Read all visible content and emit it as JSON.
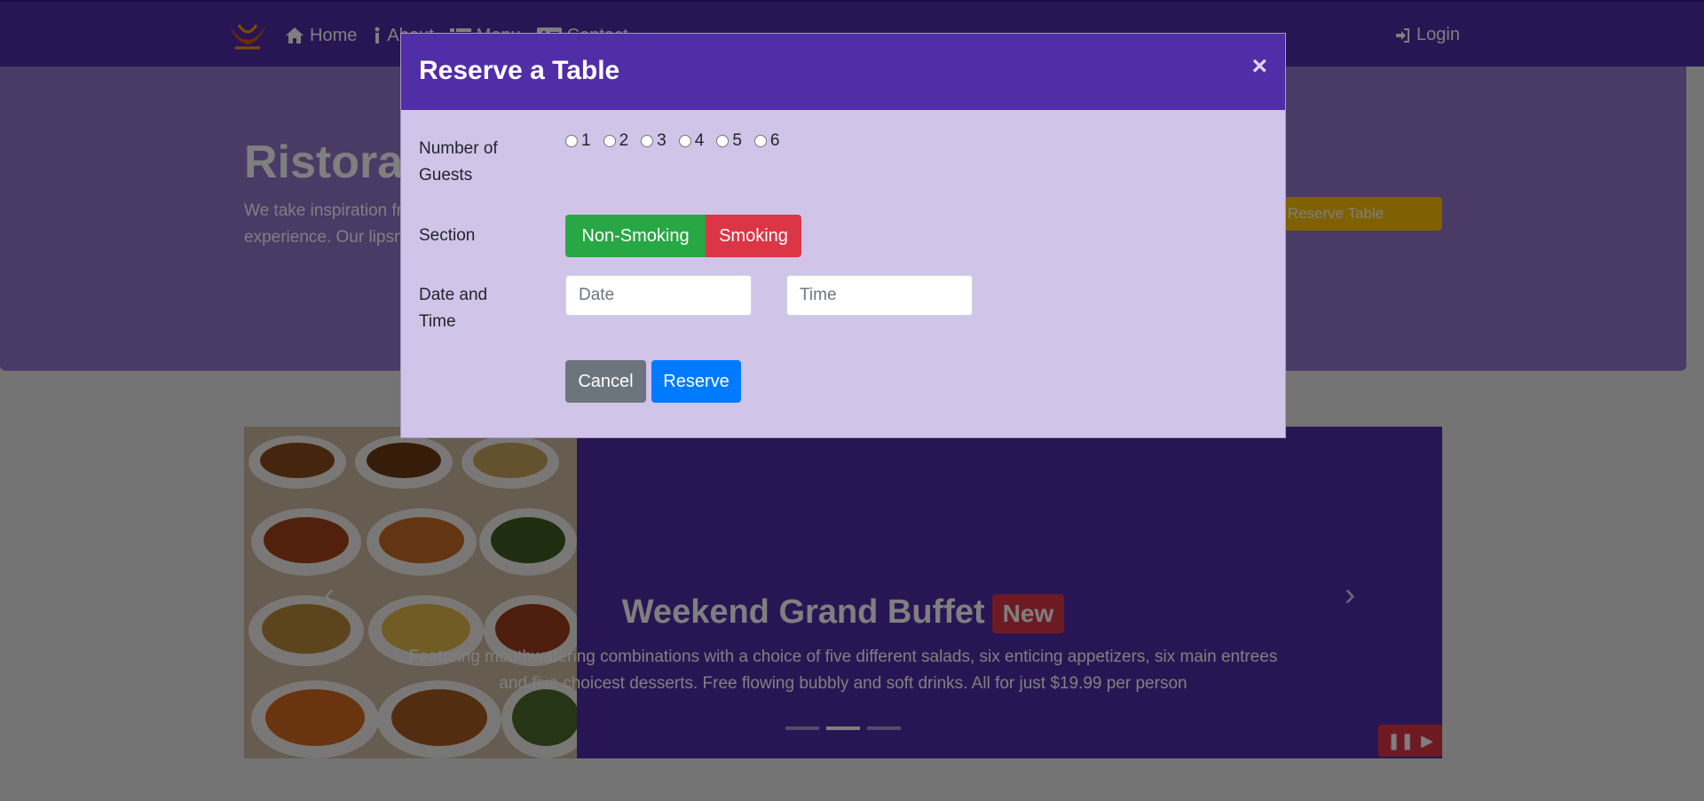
{
  "navbar": {
    "links": [
      {
        "label": "Home",
        "icon": "home-icon"
      },
      {
        "label": "About",
        "icon": "info-icon"
      },
      {
        "label": "Menu",
        "icon": "list-icon"
      },
      {
        "label": "Contact",
        "icon": "address-card-icon"
      }
    ],
    "login_label": "Login"
  },
  "hero": {
    "title": "Ristorante con Fusion",
    "text": "We take inspiration from the World's best cuisines, and create a unique fusion experience. Our lipsmacking creations will tickle your culinary senses!",
    "reserve_button": "Reserve Table"
  },
  "carousel": {
    "title": "Weekend Grand Buffet",
    "badge": "New",
    "text": "Featuring mouthwatering combinations with a choice of five different salads, six enticing appetizers, six main entrees and five choicest desserts. Free flowing bubbly and soft drinks. All for just $19.99 per person",
    "prev_symbol": "‹",
    "next_symbol": "›",
    "pause_symbol": "❚❚",
    "play_symbol": "▶"
  },
  "modal": {
    "title": "Reserve a Table",
    "close_symbol": "×",
    "guests_label": "Number of Guests",
    "guest_options": [
      "1",
      "2",
      "3",
      "4",
      "5",
      "6"
    ],
    "section_label": "Section",
    "non_smoking": "Non-Smoking",
    "smoking": "Smoking",
    "datetime_label": "Date and Time",
    "date_placeholder": "Date",
    "time_placeholder": "Time",
    "cancel": "Cancel",
    "reserve": "Reserve"
  },
  "colors": {
    "primary": "#512da8",
    "jumbotron": "#9575cd",
    "modal_body": "#d1c4e9",
    "success": "#28a745",
    "danger": "#dc3545",
    "secondary": "#6c757d",
    "blue": "#007bff",
    "warning": "#ffc107"
  }
}
